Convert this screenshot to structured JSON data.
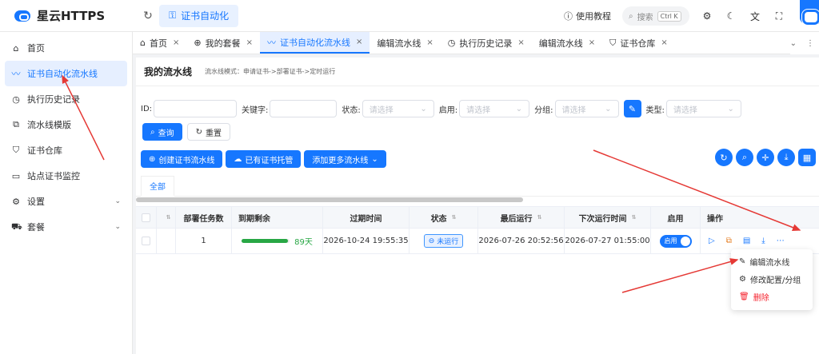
{
  "app": {
    "title": "星云HTTPS"
  },
  "topbar": {
    "current_route": "证书自动化",
    "help": "使用教程",
    "search_placeholder": "搜索",
    "search_shortcut": "Ctrl K"
  },
  "sidebar": {
    "items": [
      {
        "label": "首页",
        "icon": "home-icon"
      },
      {
        "label": "证书自动化流水线",
        "icon": "pipeline-icon",
        "active": true
      },
      {
        "label": "执行历史记录",
        "icon": "history-icon"
      },
      {
        "label": "流水线模版",
        "icon": "template-icon"
      },
      {
        "label": "证书仓库",
        "icon": "shield-icon"
      },
      {
        "label": "站点证书监控",
        "icon": "monitor-icon"
      },
      {
        "label": "设置",
        "icon": "gear-icon"
      },
      {
        "label": "套餐",
        "icon": "cart-icon"
      }
    ]
  },
  "tabs": [
    {
      "label": "首页",
      "icon": "home-icon"
    },
    {
      "label": "我的套餐",
      "icon": "package-icon"
    },
    {
      "label": "证书自动化流水线",
      "icon": "pipeline-icon",
      "active": true
    },
    {
      "label": "编辑流水线"
    },
    {
      "label": "执行历史记录",
      "icon": "history-icon"
    },
    {
      "label": "编辑流水线"
    },
    {
      "label": "证书仓库",
      "icon": "shield-icon"
    }
  ],
  "page": {
    "title": "我的流水线",
    "subtitle": "流水线模式：申请证书->部署证书->定时运行"
  },
  "filters": {
    "id_label": "ID:",
    "keyword_label": "关键字:",
    "status_label": "状态:",
    "enabled_label": "启用:",
    "group_label": "分组:",
    "type_label": "类型:",
    "select_placeholder": "请选择",
    "query_button": "查询",
    "reset_button": "重置"
  },
  "actions": {
    "create_button": "创建证书流水线",
    "hosted_button": "已有证书托管",
    "add_more_button": "添加更多流水线"
  },
  "status_tabs": {
    "all": "全部"
  },
  "table": {
    "headers": {
      "deploy_count": "部署任务数",
      "expire_remaining": "到期剩余",
      "expire_time": "过期时间",
      "status": "状态",
      "last_run": "最后运行",
      "next_run": "下次运行时间",
      "enabled": "启用",
      "operations": "操作"
    },
    "rows": [
      {
        "deploy_count": "1",
        "expire_remaining": "89天",
        "expire_progress": 0.97,
        "expire_time": "2026-10-24 19:55:35",
        "status": "未运行",
        "last_run": "2026-07-26 20:52:56",
        "next_run": "2026-07-27 01:55:00",
        "enabled": "启用"
      }
    ]
  },
  "dropdown": {
    "edit": "编辑流水线",
    "config": "修改配置/分组",
    "delete": "删除"
  },
  "colors": {
    "primary": "#1677ff",
    "success": "#28a745",
    "danger": "#f5222d",
    "annotation": "#e53935"
  }
}
